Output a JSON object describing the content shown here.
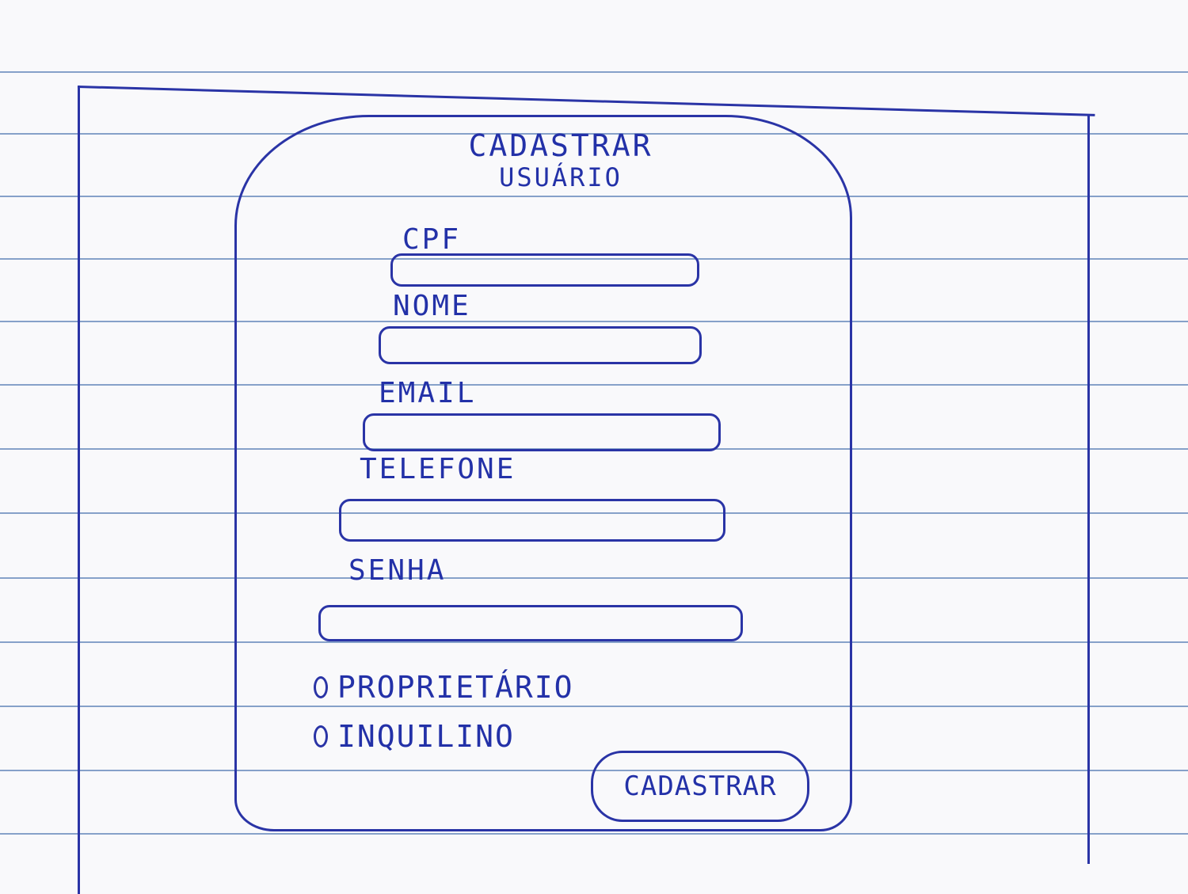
{
  "form": {
    "title_line1": "CADASTRAR",
    "title_line2": "USUÁRIO",
    "fields": [
      {
        "label": "CPF",
        "value": ""
      },
      {
        "label": "NOME",
        "value": ""
      },
      {
        "label": "EMAIL",
        "value": ""
      },
      {
        "label": "TELEFONE",
        "value": ""
      },
      {
        "label": "SENHA",
        "value": ""
      }
    ],
    "radio_options": [
      {
        "label": "PROPRIETÁRIO"
      },
      {
        "label": "INQUILINO"
      }
    ],
    "submit_label": "CADASTRAR"
  },
  "colors": {
    "ink": "#2331a8",
    "ruled_lines": "#5f83b8",
    "paper": "#f9f9fb"
  }
}
